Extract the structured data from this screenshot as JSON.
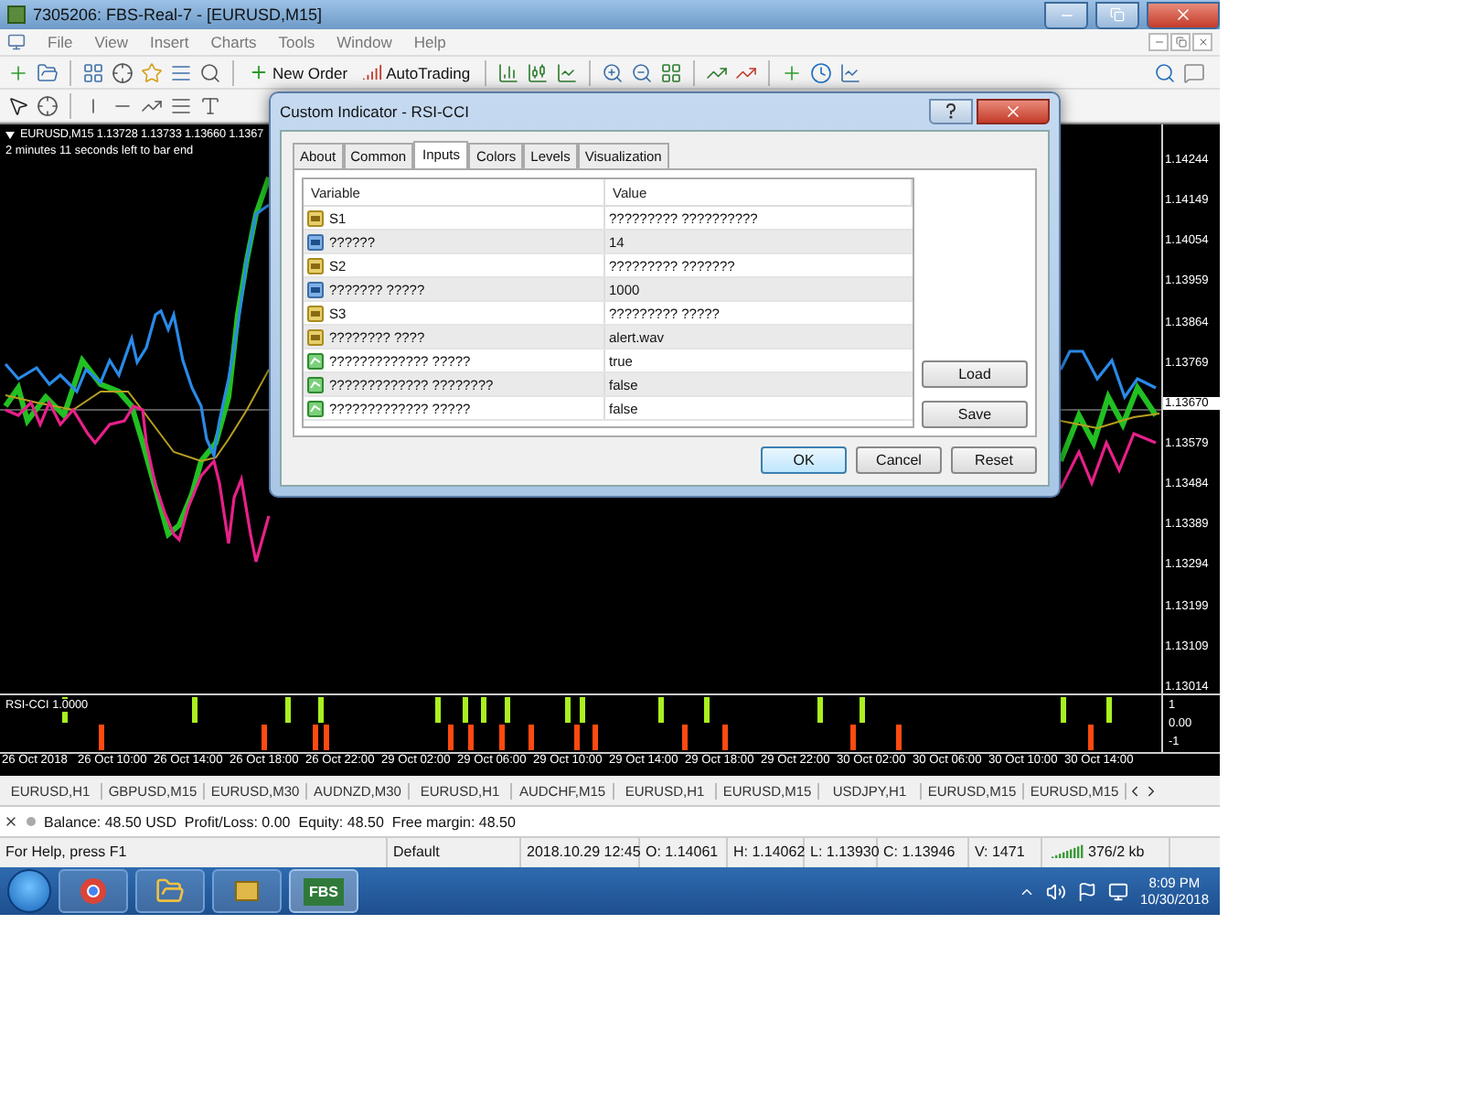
{
  "window": {
    "title": "7305206: FBS-Real-7 - [EURUSD,M15]"
  },
  "menu": [
    "File",
    "View",
    "Insert",
    "Charts",
    "Tools",
    "Window",
    "Help"
  ],
  "toolbar": {
    "buttons": [
      "New Order",
      "AutoTrading"
    ]
  },
  "chart": {
    "info": "EURUSD,M15  1.13728 1.13733 1.13660 1.1367",
    "countdown": "2 minutes 11 seconds left to bar end",
    "price_labels": [
      {
        "text": "1.14244",
        "current": false
      },
      {
        "text": "1.14149",
        "current": false
      },
      {
        "text": "1.14054",
        "current": false
      },
      {
        "text": "1.13959",
        "current": false
      },
      {
        "text": "1.13864",
        "current": false
      },
      {
        "text": "1.13769",
        "current": false
      },
      {
        "text": "1.13670",
        "current": true
      },
      {
        "text": "1.13579",
        "current": false
      },
      {
        "text": "1.13484",
        "current": false
      },
      {
        "text": "1.13389",
        "current": false
      },
      {
        "text": "1.13294",
        "current": false
      },
      {
        "text": "1.13199",
        "current": false
      },
      {
        "text": "1.13109",
        "current": false
      },
      {
        "text": "1.13014",
        "current": false
      }
    ],
    "indicator": {
      "label": "RSI-CCI 1.0000",
      "scale": [
        "1",
        "0.00",
        "-1"
      ]
    },
    "time_labels": [
      "26 Oct 2018",
      "26 Oct 10:00",
      "26 Oct 14:00",
      "26 Oct 18:00",
      "26 Oct 22:00",
      "29 Oct 02:00",
      "29 Oct 06:00",
      "29 Oct 10:00",
      "29 Oct 14:00",
      "29 Oct 18:00",
      "29 Oct 22:00",
      "30 Oct 02:00",
      "30 Oct 06:00",
      "30 Oct 10:00",
      "30 Oct 14:00"
    ]
  },
  "symbol_tabs": [
    "EURUSD,H1",
    "GBPUSD,M15",
    "EURUSD,M30",
    "AUDNZD,M30",
    "EURUSD,H1",
    "AUDCHF,M15",
    "EURUSD,H1",
    "EURUSD,M15",
    "USDJPY,H1",
    "EURUSD,M15",
    "EURUSD,M15"
  ],
  "terminal": {
    "summary": "Balance: 48.50 USD  Profit/Loss: 0.00  Equity: 48.50  Free margin: 48.50"
  },
  "status_bar": [
    "For Help, press F1",
    "Default",
    "2018.10.29 12:45",
    "O: 1.14061",
    "H: 1.14062",
    "L: 1.13930",
    "C: 1.13946",
    "V: 1471",
    "376/2 kb"
  ],
  "taskbar": {
    "app_label": "FBS",
    "time": "8:09 PM",
    "date": "10/30/2018"
  },
  "dialog": {
    "title": "Custom Indicator - RSI-CCI",
    "tabs": [
      {
        "label": "About",
        "selected": false
      },
      {
        "label": "Common",
        "selected": false
      },
      {
        "label": "Inputs",
        "selected": true
      },
      {
        "label": "Colors",
        "selected": false
      },
      {
        "label": "Levels",
        "selected": false
      },
      {
        "label": "Visualization",
        "selected": false
      }
    ],
    "columns": [
      "Variable",
      "Value"
    ],
    "rows": [
      {
        "kind": "text",
        "variable": "S1",
        "value": "????????? ??????????"
      },
      {
        "kind": "number",
        "variable": "??????",
        "value": "14"
      },
      {
        "kind": "text",
        "variable": "S2",
        "value": "????????? ???????"
      },
      {
        "kind": "number",
        "variable": "??????? ?????",
        "value": "1000"
      },
      {
        "kind": "text",
        "variable": "S3",
        "value": "????????? ?????"
      },
      {
        "kind": "text",
        "variable": "???????? ????",
        "value": "alert.wav"
      },
      {
        "kind": "bool",
        "variable": "????????????? ?????",
        "value": "true"
      },
      {
        "kind": "bool",
        "variable": "????????????? ????????",
        "value": "false"
      },
      {
        "kind": "bool",
        "variable": "????????????? ?????",
        "value": "false"
      }
    ],
    "side_buttons": [
      "Load",
      "Save"
    ],
    "buttons": [
      {
        "label": "OK",
        "default": true
      },
      {
        "label": "Cancel",
        "default": false
      },
      {
        "label": "Reset",
        "default": false
      }
    ]
  }
}
